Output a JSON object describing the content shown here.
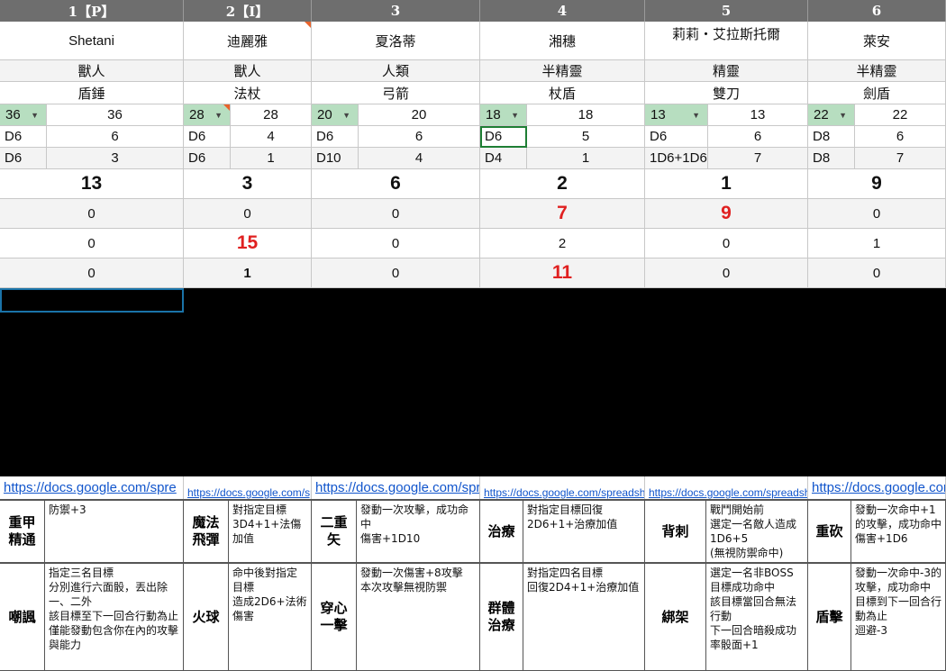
{
  "columns": [
    {
      "header": "1【P】",
      "name": "Shetani",
      "race": "獸人",
      "weapon": "盾錘",
      "hp": "36",
      "hp_max": "36",
      "d1": "D6",
      "v1": "6",
      "d2": "D6",
      "v2": "3",
      "total": "13",
      "r1": "0",
      "r2": "0",
      "r3": "0",
      "link": "https://docs.google.com/spre",
      "skills": [
        {
          "name": "重甲\n精通",
          "desc": "防禦+3"
        },
        {
          "name": "嘲諷",
          "desc": "指定三名目標\n分別進行六面骰，丟出除一、二外\n該目標至下一回合行動為止\n僅能發動包含你在內的攻擊與能力"
        }
      ]
    },
    {
      "header": "2【I】",
      "name": "迪麗雅",
      "race": "獸人",
      "weapon": "法杖",
      "hp": "28",
      "hp_max": "28",
      "d1": "D6",
      "v1": "4",
      "d2": "D6",
      "v2": "1",
      "total": "3",
      "r1": "0",
      "r2": "15",
      "r3": "1",
      "link": "https://docs.google.com/spreadsheets",
      "skills": [
        {
          "name": "魔法\n飛彈",
          "desc": "對指定目標\n3D4+1+法傷加值"
        },
        {
          "name": "火球",
          "desc": "命中後對指定目標\n造成2D6+法術傷害"
        }
      ]
    },
    {
      "header": "3",
      "name": "夏洛蒂",
      "race": "人類",
      "weapon": "弓箭",
      "hp": "20",
      "hp_max": "20",
      "d1": "D6",
      "v1": "6",
      "d2": "D10",
      "v2": "4",
      "total": "6",
      "r1": "0",
      "r2": "0",
      "r3": "0",
      "link": "https://docs.google.com/spre",
      "skills": [
        {
          "name": "二重\n矢",
          "desc": "發動一次攻擊，成功命中\n傷害+1D10"
        },
        {
          "name": "穿心\n一擊",
          "desc": "發動一次傷害+8攻擊\n本次攻擊無視防禦"
        }
      ]
    },
    {
      "header": "4",
      "name": "湘穗",
      "race": "半精靈",
      "weapon": "杖盾",
      "hp": "18",
      "hp_max": "18",
      "d1": "D6",
      "v1": "5",
      "d2": "D4",
      "v2": "1",
      "total": "2",
      "r1": "7",
      "r2": "2",
      "r3": "11",
      "link": "https://docs.google.com/spreadsheets",
      "skills": [
        {
          "name": "治療",
          "desc": "對指定目標回復\n2D6+1+治療加值"
        },
        {
          "name": "群體\n治療",
          "desc": "對指定四名目標\n回復2D4+1+治療加值"
        }
      ]
    },
    {
      "header": "5",
      "name": "莉莉・艾拉斯托爾",
      "race": "精靈",
      "weapon": "雙刀",
      "hp": "13",
      "hp_max": "13",
      "d1": "D6",
      "v1": "6",
      "d2": "1D6+1D6",
      "v2": "7",
      "total": "1",
      "r1": "9",
      "r2": "0",
      "r3": "0",
      "link": "https://docs.google.com/spreadsheets",
      "skills": [
        {
          "name": "背刺",
          "desc": "戰鬥開始前\n選定一名敵人造成1D6+5\n(無視防禦命中)"
        },
        {
          "name": "綁架",
          "desc": "選定一名非BOSS目標成功命中\n該目標當回合無法行動\n下一回合暗殺成功率骰面+1"
        }
      ]
    },
    {
      "header": "6",
      "name": "萊安",
      "race": "半精靈",
      "weapon": "劍盾",
      "hp": "22",
      "hp_max": "22",
      "d1": "D8",
      "v1": "6",
      "d2": "D8",
      "v2": "7",
      "total": "9",
      "r1": "0",
      "r2": "1",
      "r3": "0",
      "link": "https://docs.google.com/spre",
      "skills": [
        {
          "name": "重砍",
          "desc": "發動一次命中+1的攻擊，成功命中\n傷害+1D6"
        },
        {
          "name": "盾擊",
          "desc": "發動一次命中-3的攻擊，成功命中\n目標到下一回合行動為止\n迴避-3"
        }
      ]
    }
  ],
  "colors": {
    "header_bg": "#6e6e6e",
    "hp_bg": "#b7dec0",
    "highlight": "#e02020",
    "link": "#1155cc"
  }
}
